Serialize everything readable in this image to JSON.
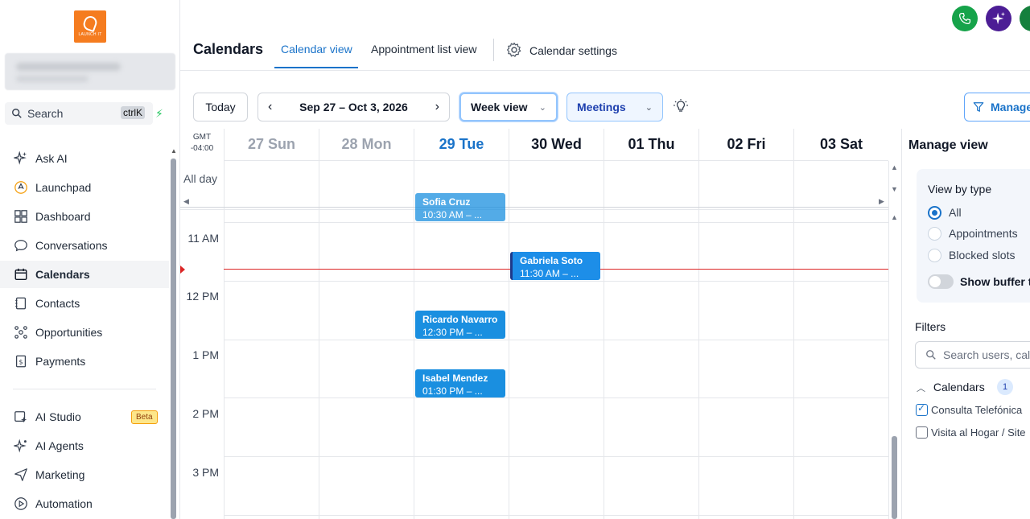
{
  "sidebar": {
    "logo_text": "LAUNCH IT",
    "search": {
      "label": "Search",
      "shortcut": "ctrlK"
    },
    "items": [
      {
        "label": "Ask AI",
        "icon": "sparkle-icon"
      },
      {
        "label": "Launchpad",
        "icon": "rocket-icon"
      },
      {
        "label": "Dashboard",
        "icon": "dashboard-icon"
      },
      {
        "label": "Conversations",
        "icon": "chat-icon"
      },
      {
        "label": "Calendars",
        "icon": "calendar-icon",
        "active": true
      },
      {
        "label": "Contacts",
        "icon": "contacts-icon"
      },
      {
        "label": "Opportunities",
        "icon": "opportunities-icon"
      },
      {
        "label": "Payments",
        "icon": "payments-icon"
      }
    ],
    "items2": [
      {
        "label": "AI Studio",
        "icon": "ai-studio-icon",
        "badge": "Beta"
      },
      {
        "label": "AI Agents",
        "icon": "ai-agents-icon"
      },
      {
        "label": "Marketing",
        "icon": "send-icon"
      },
      {
        "label": "Automation",
        "icon": "automation-icon"
      }
    ]
  },
  "header": {
    "title": "Calendars",
    "tabs": [
      {
        "label": "Calendar view",
        "active": true
      },
      {
        "label": "Appointment list view"
      },
      {
        "label": "Calendar settings"
      }
    ],
    "accent_color": "#1a73c9"
  },
  "toolbar": {
    "today": "Today",
    "date_range": "Sep 27 – Oct 3, 2026",
    "view_select": "Week view",
    "type_select": "Meetings",
    "manage_button": "Manage"
  },
  "calendar": {
    "timezone": [
      "GMT",
      "-04:00"
    ],
    "all_day_label": "All day",
    "days": [
      {
        "label": "27 Sun",
        "state": "past"
      },
      {
        "label": "28 Mon",
        "state": "past"
      },
      {
        "label": "29 Tue",
        "state": "today"
      },
      {
        "label": "30 Wed",
        "state": "future"
      },
      {
        "label": "01 Thu",
        "state": "future"
      },
      {
        "label": "02 Fri",
        "state": "future"
      },
      {
        "label": "03 Sat",
        "state": "future"
      }
    ],
    "hours": [
      "11 AM",
      "12 PM",
      "1 PM",
      "2 PM",
      "3 PM"
    ],
    "events": [
      {
        "name": "Sofia Cruz",
        "time": "10:30 AM – ...",
        "day": "29 Tue"
      },
      {
        "name": "Gabriela Soto",
        "time": "11:30 AM – ...",
        "day": "30 Wed"
      },
      {
        "name": "Ricardo Navarro",
        "time": "12:30 PM – ...",
        "day": "29 Tue"
      },
      {
        "name": "Isabel Mendez",
        "time": "01:30 PM – ...",
        "day": "29 Tue"
      }
    ]
  },
  "manage_view": {
    "title": "Manage view",
    "view_by_type": "View by type",
    "types": [
      {
        "label": "All",
        "selected": true
      },
      {
        "label": "Appointments",
        "selected": false
      },
      {
        "label": "Blocked slots",
        "selected": false
      }
    ],
    "buffer_toggle": "Show buffer time",
    "filters_label": "Filters",
    "filter_search_placeholder": "Search users, calendars",
    "calendars_group": "Calendars",
    "calendars_count": "1",
    "calendars": [
      {
        "label": "Consulta Telefónica",
        "checked": true
      },
      {
        "label": "Visita al Hogar / Site",
        "checked": false
      }
    ]
  }
}
